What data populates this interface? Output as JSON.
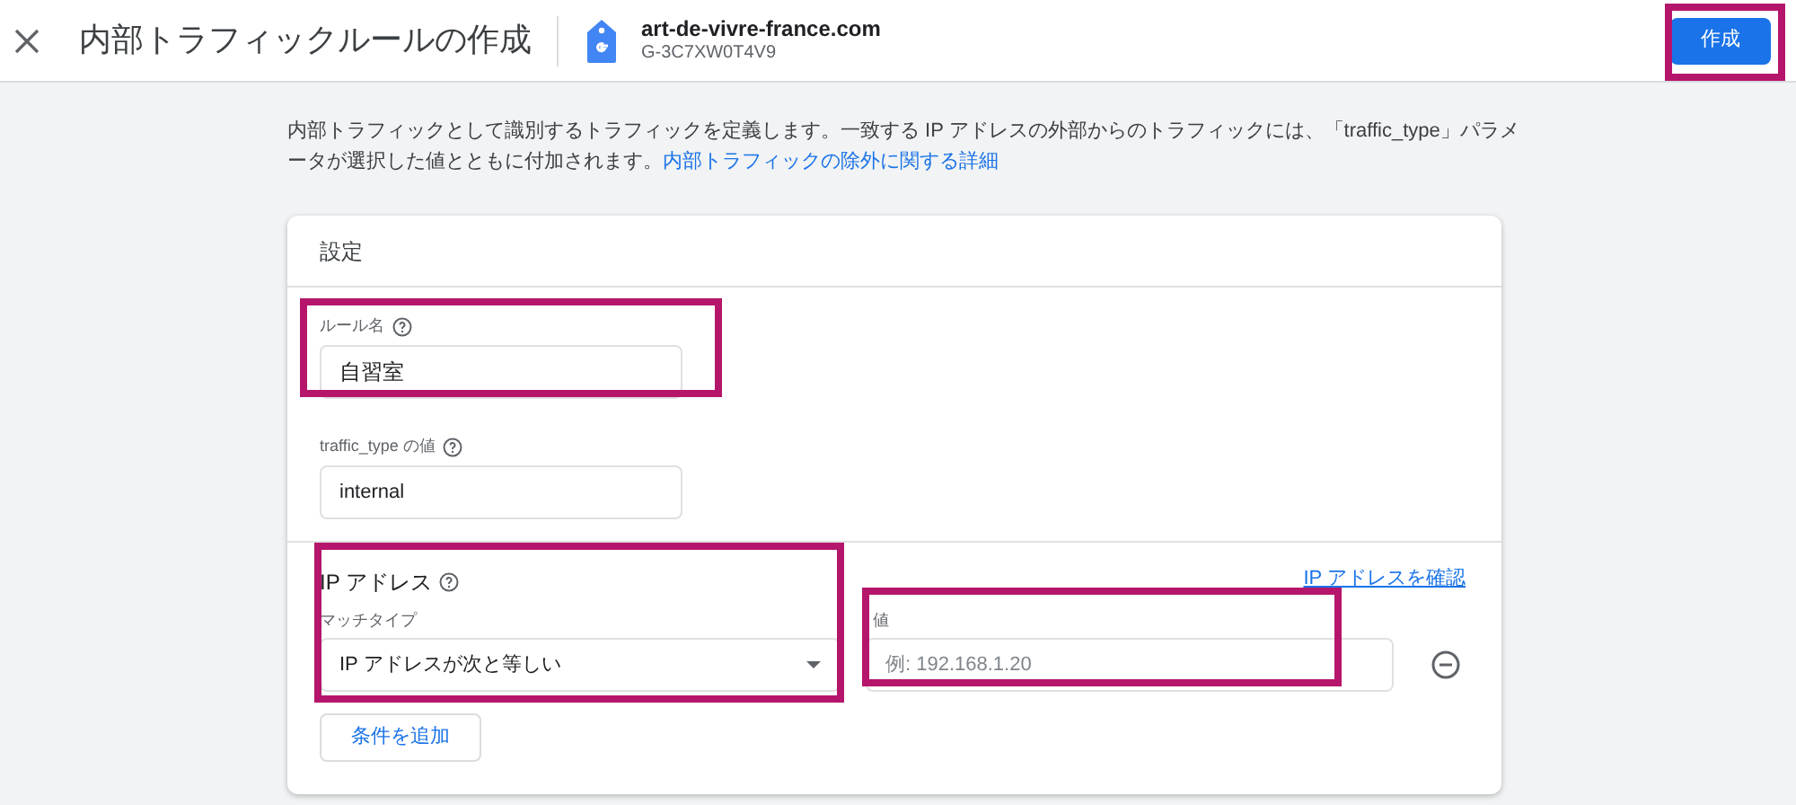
{
  "header": {
    "title": "内部トラフィックルールの作成",
    "property_name": "art-de-vivre-france.com",
    "property_id": "G-3C7XW0T4V9",
    "create_button": "作成"
  },
  "description": {
    "text": "内部トラフィックとして識別するトラフィックを定義します。一致する IP アドレスの外部からのトラフィックには、「traffic_type」パラメータが選択した値とともに付加されます。",
    "link": "内部トラフィックの除外に関する詳細"
  },
  "card": {
    "title": "設定",
    "rule_name": {
      "label": "ルール名",
      "value": "自習室"
    },
    "traffic_type": {
      "label": "traffic_type の値",
      "value": "internal"
    },
    "ip_section": {
      "title": "IP アドレス",
      "check_link": "IP アドレスを確認",
      "match_type_label": "マッチタイプ",
      "match_type_value": "IP アドレスが次と等しい",
      "value_label": "値",
      "value_placeholder": "例: 192.168.1.20",
      "add_condition_button": "条件を追加"
    }
  }
}
